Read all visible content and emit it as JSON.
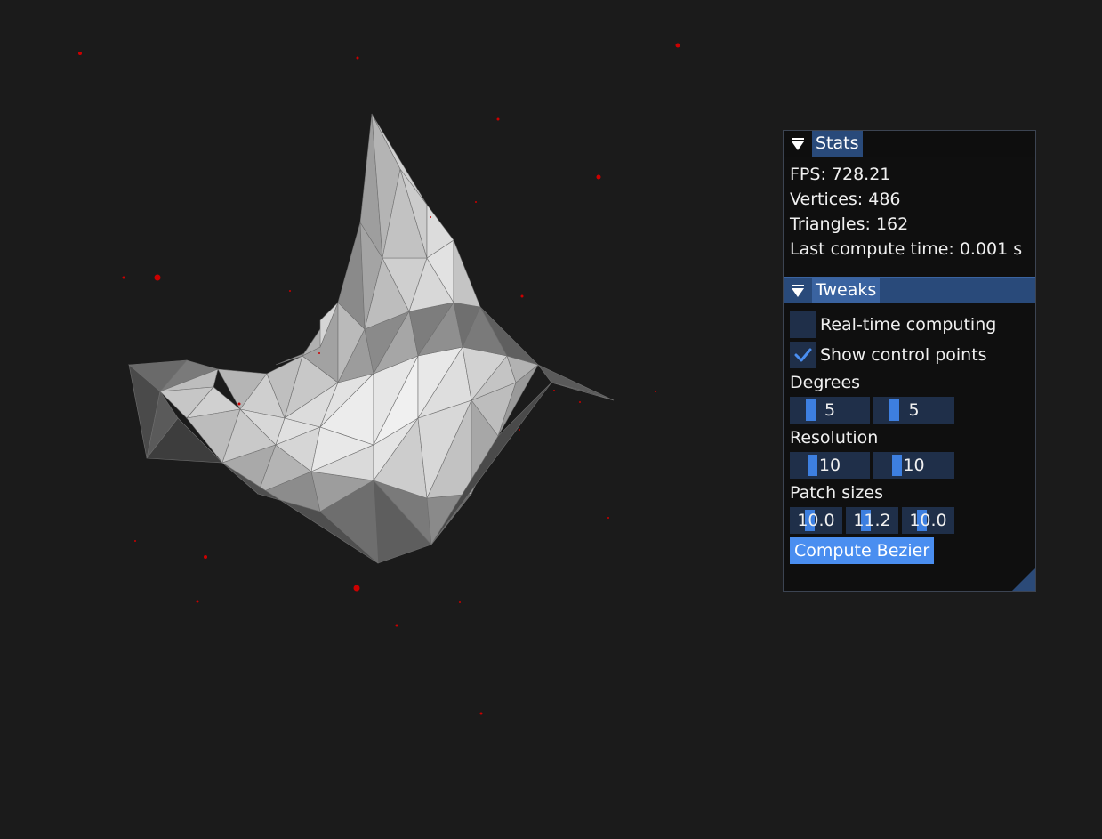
{
  "stats": {
    "title": "Stats",
    "fps": "FPS: 728.21",
    "vertices": "Vertices: 486",
    "triangles": "Triangles: 162",
    "compute_time": "Last compute time: 0.001 s"
  },
  "tweaks": {
    "title": "Tweaks",
    "realtime_label": "Real-time computing",
    "realtime_checked": false,
    "control_points_label": "Show control points",
    "control_points_checked": true,
    "degrees_label": "Degrees",
    "degrees": [
      "5",
      "5"
    ],
    "resolution_label": "Resolution",
    "resolution": [
      "10",
      "10"
    ],
    "patch_label": "Patch sizes",
    "patch": [
      "10.0",
      "11.2",
      "10.0"
    ],
    "compute_button": "Compute Bezier"
  },
  "colors": {
    "background": "#1b1b1b",
    "accent": "#4a8ef0",
    "header": "#294a7a",
    "control_point": "#cc0000"
  }
}
